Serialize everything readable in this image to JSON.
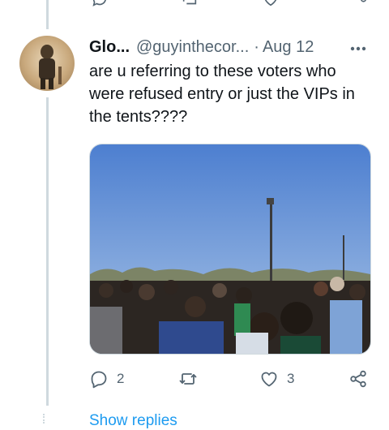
{
  "tweet": {
    "author_name": "Glo...",
    "author_handle": "@guyinthecor...",
    "separator": "·",
    "date": "Aug 12",
    "text": "are u referring to these voters who were refused entry or just the VIPs in the tents????",
    "reply_count": "2",
    "like_count": "3"
  },
  "show_replies_label": "Show replies",
  "icons": {
    "reply": "reply-icon",
    "retweet": "retweet-icon",
    "like": "heart-icon",
    "share": "share-icon",
    "more": "more-icon"
  },
  "colors": {
    "text": "#0f1419",
    "secondary": "#536471",
    "link": "#1d9bf0",
    "thread_line": "#cfd9de"
  }
}
